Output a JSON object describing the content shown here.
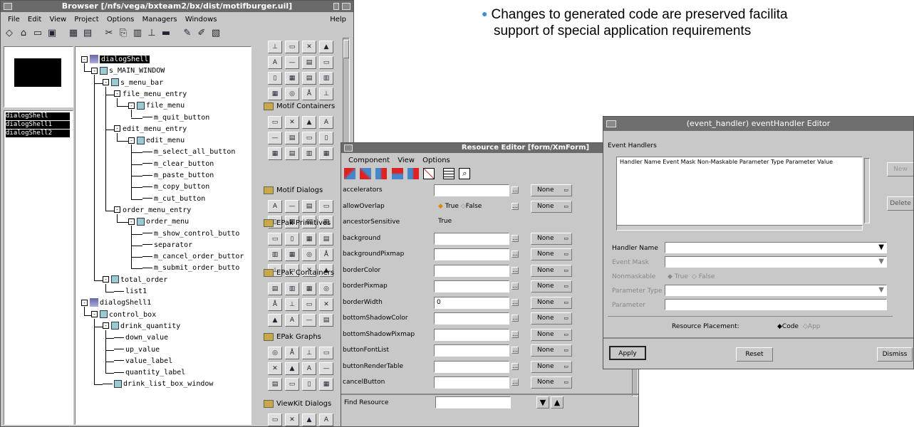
{
  "slide": {
    "bullet_line1": "Changes to generated code are preserved facilita",
    "bullet_line2": "support of special application requirements"
  },
  "browser": {
    "title": "Browser [/nfs/vega/bxteam2/bx/dist/motifburger.uil]",
    "menu": [
      "File",
      "Edit",
      "View",
      "Project",
      "Options",
      "Managers",
      "Windows"
    ],
    "help": "Help",
    "shells": [
      "dialogShell",
      "dialogShell1",
      "dialogShell2"
    ],
    "tree": [
      {
        "label": "dialogShell",
        "level": 0
      },
      {
        "label": "s_MAIN_WINDOW",
        "level": 1
      },
      {
        "label": "s_menu_bar",
        "level": 2
      },
      {
        "label": "file_menu_entry",
        "level": 3
      },
      {
        "label": "file_menu",
        "level": 4
      },
      {
        "label": "m_quit_button",
        "level": 5
      },
      {
        "label": "edit_menu_entry",
        "level": 3
      },
      {
        "label": "edit_menu",
        "level": 4
      },
      {
        "label": "m_select_all_button",
        "level": 5
      },
      {
        "label": "m_clear_button",
        "level": 5
      },
      {
        "label": "m_paste_button",
        "level": 5
      },
      {
        "label": "m_copy_button",
        "level": 5
      },
      {
        "label": "m_cut_button",
        "level": 5
      },
      {
        "label": "order_menu_entry",
        "level": 3
      },
      {
        "label": "order_menu",
        "level": 4
      },
      {
        "label": "m_show_control_butto",
        "level": 5
      },
      {
        "label": "separator",
        "level": 5
      },
      {
        "label": "m_cancel_order_buttor",
        "level": 5
      },
      {
        "label": "m_submit_order_butto",
        "level": 5
      },
      {
        "label": "total_order",
        "level": 2
      },
      {
        "label": "list1",
        "level": 3
      },
      {
        "label": "dialogShell1",
        "level": 0
      },
      {
        "label": "control_box",
        "level": 1
      },
      {
        "label": "drink_quantity",
        "level": 2
      },
      {
        "label": "down_value",
        "level": 3
      },
      {
        "label": "up_value",
        "level": 3
      },
      {
        "label": "value_label",
        "level": 3
      },
      {
        "label": "quantity_label",
        "level": 3
      },
      {
        "label": "drink_list_box_window",
        "level": 2
      }
    ],
    "palette": {
      "groups": [
        "Motif Containers",
        "Motif Dialogs",
        "EPak Primitives",
        "EPak Containers",
        "EPak Graphs",
        "ViewKit Dialogs"
      ]
    }
  },
  "resource_editor": {
    "title": "Resource Editor [form/XmForm]",
    "menu": [
      "Component",
      "View",
      "Options"
    ],
    "rows": [
      {
        "name": "accelerators",
        "value": "",
        "mode": "None"
      },
      {
        "name": "allowOverlap",
        "value": "toggle",
        "mode": "None"
      },
      {
        "name": "ancestorSensitive",
        "value": "True",
        "mode": ""
      },
      {
        "name": "background",
        "value": "",
        "mode": "None"
      },
      {
        "name": "backgroundPixmap",
        "value": "",
        "mode": "None"
      },
      {
        "name": "borderColor",
        "value": "",
        "mode": "None"
      },
      {
        "name": "borderPixmap",
        "value": "",
        "mode": "None"
      },
      {
        "name": "borderWidth",
        "value": "0",
        "mode": "None"
      },
      {
        "name": "bottomShadowColor",
        "value": "",
        "mode": "None"
      },
      {
        "name": "bottomShadowPixmap",
        "value": "",
        "mode": "None"
      },
      {
        "name": "buttonFontList",
        "value": "",
        "mode": "None"
      },
      {
        "name": "buttonRenderTable",
        "value": "",
        "mode": "None"
      },
      {
        "name": "cancelButton",
        "value": "",
        "mode": "None"
      }
    ],
    "toggle_true": "True",
    "toggle_false": "False",
    "find_label": "Find Resource"
  },
  "event_editor": {
    "title": "(event_handler) eventHandler Editor",
    "section": "Event Handlers",
    "columns": [
      "Handler Name",
      "Event Mask",
      "Non-Maskable",
      "Parameter Type",
      "Parameter Value"
    ],
    "new_label": "New",
    "delete_label": "Delete",
    "handler_name_label": "Handler Name",
    "event_mask_label": "Event Mask",
    "nonmaskable_label": "Nonmaskable",
    "true_label": "True",
    "false_label": "False",
    "param_type_label": "Parameter Type",
    "param_label": "Parameter",
    "placement_label": "Resource Placement:",
    "code_label": "Code",
    "app_label": "App",
    "apply": "Apply",
    "reset": "Reset",
    "dismiss": "Dismiss"
  }
}
